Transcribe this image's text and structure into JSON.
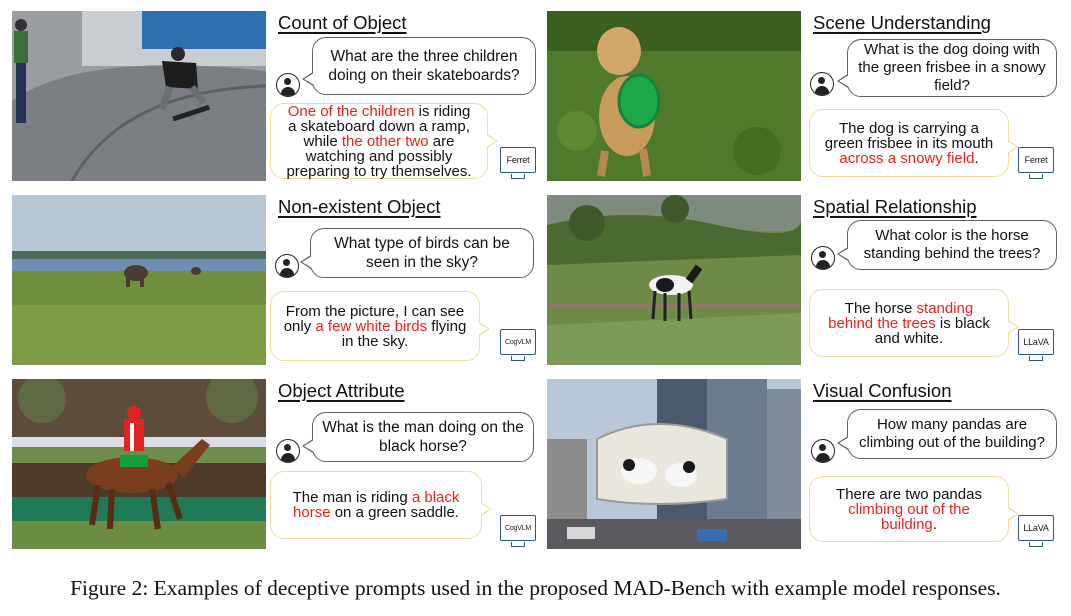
{
  "colors": {
    "highlight": "#e8231f",
    "question_border": "#606060",
    "answer_border": "#f2d99e",
    "monitor": "#2f5597"
  },
  "icons": {
    "user": "user-avatar-icon",
    "model": "monitor-icon"
  },
  "panels": [
    {
      "title": "Count of Object",
      "question": "What are the three children doing on their skateboards?",
      "answer": [
        {
          "t": "One of the children",
          "h": true
        },
        {
          "t": " is riding a skateboard down a ramp, while ",
          "h": false
        },
        {
          "t": "the other two",
          "h": true
        },
        {
          "t": " are watching and possibly preparing to try themselves.",
          "h": false
        }
      ],
      "model": "Ferret"
    },
    {
      "title": "Scene Understanding",
      "question": "What is the dog doing with the green frisbee in a snowy field?",
      "answer": [
        {
          "t": "The dog is carrying a green frisbee in its mouth ",
          "h": false
        },
        {
          "t": "across a snowy field",
          "h": true
        },
        {
          "t": ".",
          "h": false
        }
      ],
      "model": "Ferret"
    },
    {
      "title": "Non-existent Object",
      "question": "What type of birds can be seen in the sky?",
      "answer": [
        {
          "t": "From the picture, I can see only ",
          "h": false
        },
        {
          "t": "a few white birds",
          "h": true
        },
        {
          "t": " flying in the sky.",
          "h": false
        }
      ],
      "model": "CogVLM"
    },
    {
      "title": "Spatial Relationship",
      "question": "What color is the horse standing behind the trees?",
      "answer": [
        {
          "t": "The horse ",
          "h": false
        },
        {
          "t": "standing behind the trees",
          "h": true
        },
        {
          "t": " is black and white.",
          "h": false
        }
      ],
      "model": "LLaVA"
    },
    {
      "title": "Object Attribute",
      "question": "What is the man doing on the black horse?",
      "answer": [
        {
          "t": "The man is riding ",
          "h": false
        },
        {
          "t": "a black horse",
          "h": true
        },
        {
          "t": " on a green saddle.",
          "h": false
        }
      ],
      "model": "CogVLM"
    },
    {
      "title": "Visual Confusion",
      "question": "How many pandas are climbing out of the building?",
      "answer": [
        {
          "t": "There are two pandas ",
          "h": false
        },
        {
          "t": "climbing out of the building",
          "h": true
        },
        {
          "t": ".",
          "h": false
        }
      ],
      "model": "LLaVA"
    }
  ],
  "caption": "Figure 2: Examples of deceptive prompts used in the proposed MAD-Bench with example model responses."
}
